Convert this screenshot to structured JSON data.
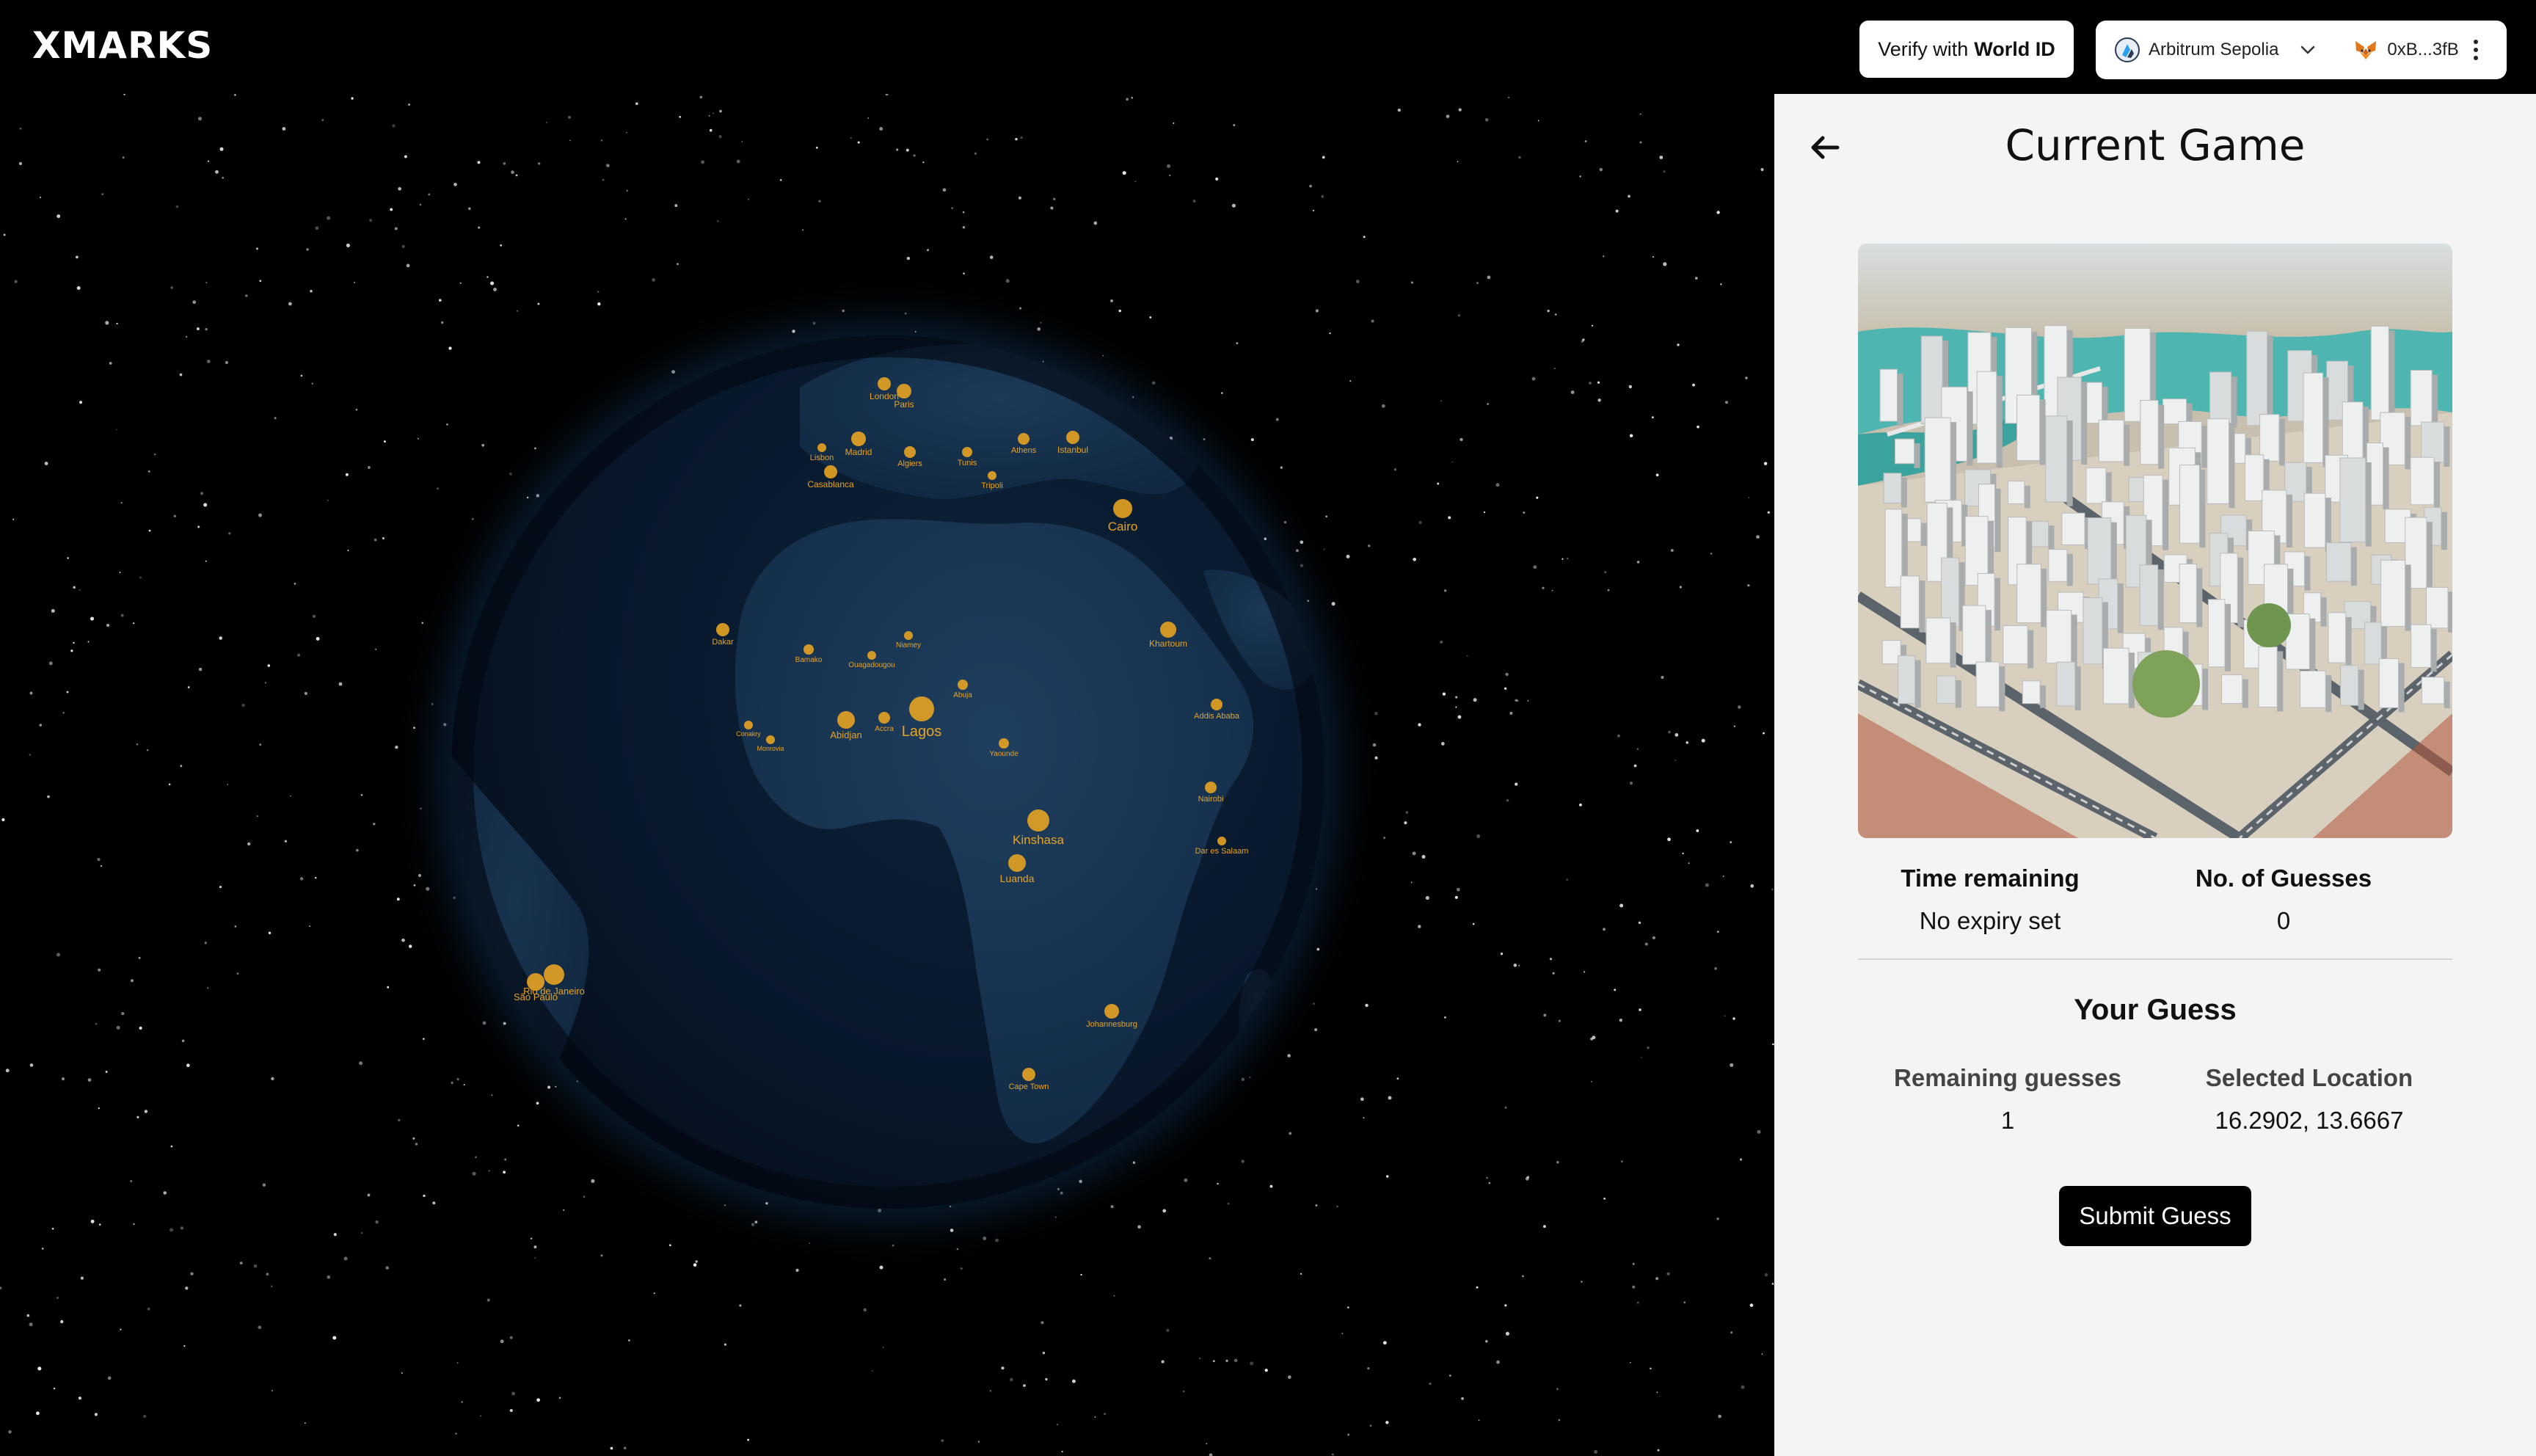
{
  "app": {
    "logo": "XMARKS"
  },
  "topbar": {
    "verify_prefix": "Verify with",
    "verify_strong": "World ID",
    "network": "Arbitrum Sepolia",
    "account": "0xB...3fB"
  },
  "globe": {
    "cities": [
      {
        "label": "London"
      },
      {
        "label": "Paris"
      },
      {
        "label": "Madrid"
      },
      {
        "label": "Lisbon"
      },
      {
        "label": "Casablanca"
      },
      {
        "label": "Algiers"
      },
      {
        "label": "Tunis"
      },
      {
        "label": "Tripoli"
      },
      {
        "label": "Athens"
      },
      {
        "label": "Istanbul"
      },
      {
        "label": "Cairo"
      },
      {
        "label": "Khartoum"
      },
      {
        "label": "Dakar"
      },
      {
        "label": "Bamako"
      },
      {
        "label": "Ouagadougou"
      },
      {
        "label": "Niamey"
      },
      {
        "label": "Abuja"
      },
      {
        "label": "Abidjan"
      },
      {
        "label": "Accra"
      },
      {
        "label": "Lagos"
      },
      {
        "label": "Yaounde"
      },
      {
        "label": "Addis Ababa"
      },
      {
        "label": "Kinshasa"
      },
      {
        "label": "Luanda"
      },
      {
        "label": "Nairobi"
      },
      {
        "label": "Dar es Salaam"
      },
      {
        "label": "Johannesburg"
      },
      {
        "label": "Cape Town"
      },
      {
        "label": "Rio de Janeiro"
      },
      {
        "label": "São Paulo"
      },
      {
        "label": "Conakry"
      },
      {
        "label": "Monrovia"
      }
    ]
  },
  "panel": {
    "title": "Current Game",
    "stats": {
      "time_label": "Time remaining",
      "time_value": "No expiry set",
      "guesses_label": "No. of Guesses",
      "guesses_value": "0"
    },
    "your_guess": {
      "title": "Your Guess",
      "remaining_label": "Remaining guesses",
      "remaining_value": "1",
      "location_label": "Selected Location",
      "location_value": "16.2902, 13.6667"
    },
    "submit_label": "Submit Guess"
  },
  "colors": {
    "accent": "#000000",
    "city": "#e7a322",
    "panel_bg": "#f4f4f4"
  }
}
